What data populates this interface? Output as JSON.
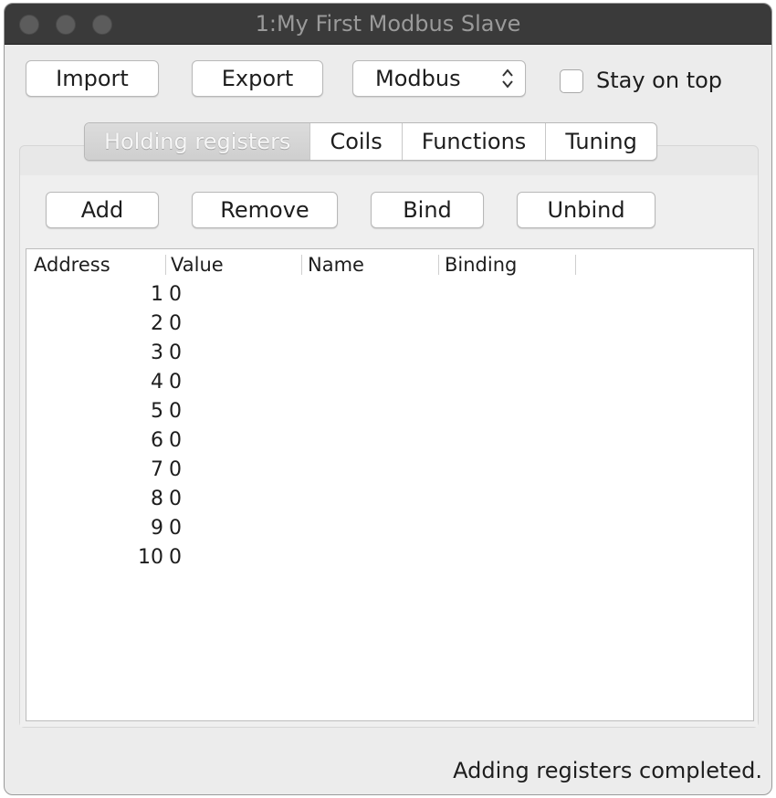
{
  "window": {
    "title": "1:My First Modbus Slave"
  },
  "toolbar": {
    "import_label": "Import",
    "export_label": "Export",
    "protocol_selected": "Modbus",
    "stay_on_top_label": "Stay on top",
    "stay_on_top_checked": false
  },
  "tabs": [
    {
      "label": "Holding registers",
      "active": true
    },
    {
      "label": "Coils",
      "active": false
    },
    {
      "label": "Functions",
      "active": false
    },
    {
      "label": "Tuning",
      "active": false
    }
  ],
  "actions": {
    "add_label": "Add",
    "remove_label": "Remove",
    "bind_label": "Bind",
    "unbind_label": "Unbind"
  },
  "table": {
    "columns": [
      "Address",
      "Value",
      "Name",
      "Binding"
    ],
    "rows": [
      {
        "address": "1",
        "value": "0"
      },
      {
        "address": "2",
        "value": "0"
      },
      {
        "address": "3",
        "value": "0"
      },
      {
        "address": "4",
        "value": "0"
      },
      {
        "address": "5",
        "value": "0"
      },
      {
        "address": "6",
        "value": "0"
      },
      {
        "address": "7",
        "value": "0"
      },
      {
        "address": "8",
        "value": "0"
      },
      {
        "address": "9",
        "value": "0"
      },
      {
        "address": "10",
        "value": "0"
      }
    ]
  },
  "status": {
    "message": "Adding registers completed."
  }
}
